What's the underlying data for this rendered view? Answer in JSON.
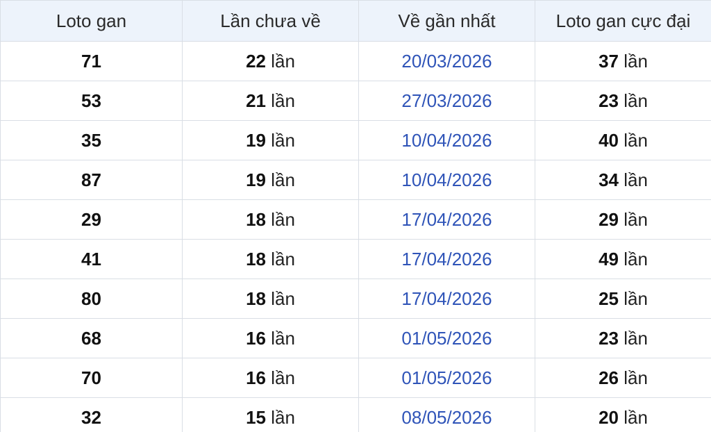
{
  "headers": {
    "col1": "Loto gan",
    "col2": "Lần chưa về",
    "col3": "Về gần nhất",
    "col4": "Loto gan cực đại"
  },
  "unit": "lần",
  "rows": [
    {
      "loto": "71",
      "missing": "22",
      "last_date": "20/03/2026",
      "max": "37"
    },
    {
      "loto": "53",
      "missing": "21",
      "last_date": "27/03/2026",
      "max": "23"
    },
    {
      "loto": "35",
      "missing": "19",
      "last_date": "10/04/2026",
      "max": "40"
    },
    {
      "loto": "87",
      "missing": "19",
      "last_date": "10/04/2026",
      "max": "34"
    },
    {
      "loto": "29",
      "missing": "18",
      "last_date": "17/04/2026",
      "max": "29"
    },
    {
      "loto": "41",
      "missing": "18",
      "last_date": "17/04/2026",
      "max": "49"
    },
    {
      "loto": "80",
      "missing": "18",
      "last_date": "17/04/2026",
      "max": "25"
    },
    {
      "loto": "68",
      "missing": "16",
      "last_date": "01/05/2026",
      "max": "23"
    },
    {
      "loto": "70",
      "missing": "16",
      "last_date": "01/05/2026",
      "max": "26"
    },
    {
      "loto": "32",
      "missing": "15",
      "last_date": "08/05/2026",
      "max": "20"
    }
  ],
  "colors": {
    "header_bg": "#edf3fb",
    "border": "#d9dee5",
    "date_link": "#2f54b8"
  }
}
